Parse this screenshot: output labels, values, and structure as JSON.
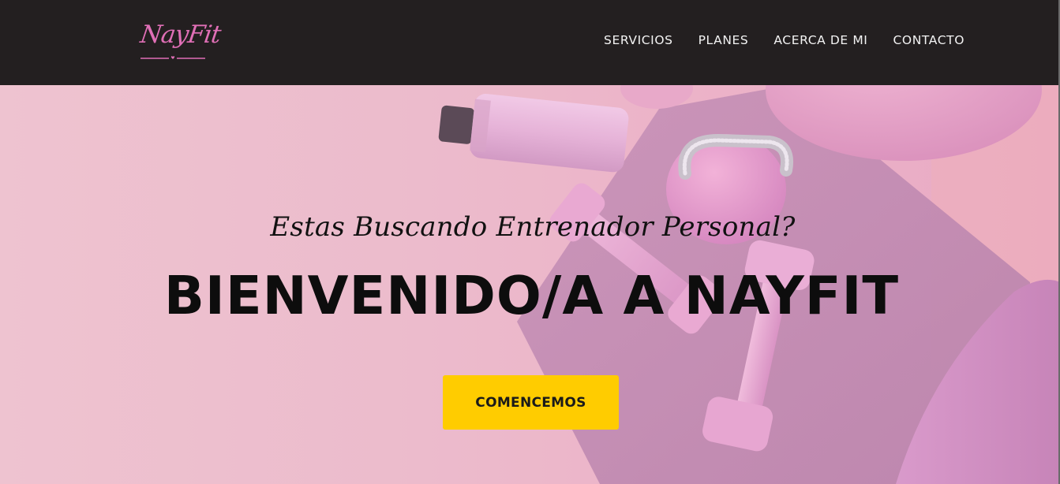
{
  "brand": {
    "logo_text": "NayFit",
    "logo_color": "#e06fb6"
  },
  "nav": {
    "items": [
      {
        "label": "SERVICIOS"
      },
      {
        "label": "PLANES"
      },
      {
        "label": "ACERCA DE MI"
      },
      {
        "label": "CONTACTO"
      }
    ]
  },
  "hero": {
    "subtitle": "Estas Buscando Entrenador Personal?",
    "title": "BIENVENIDO/A A NAYFIT",
    "cta_label": "COMENCEMOS",
    "cta_color": "#ffcc00",
    "background_color": "#ecbbcc"
  },
  "colors": {
    "navbar_bg": "#231f20",
    "nav_text": "#f3f3f3"
  }
}
